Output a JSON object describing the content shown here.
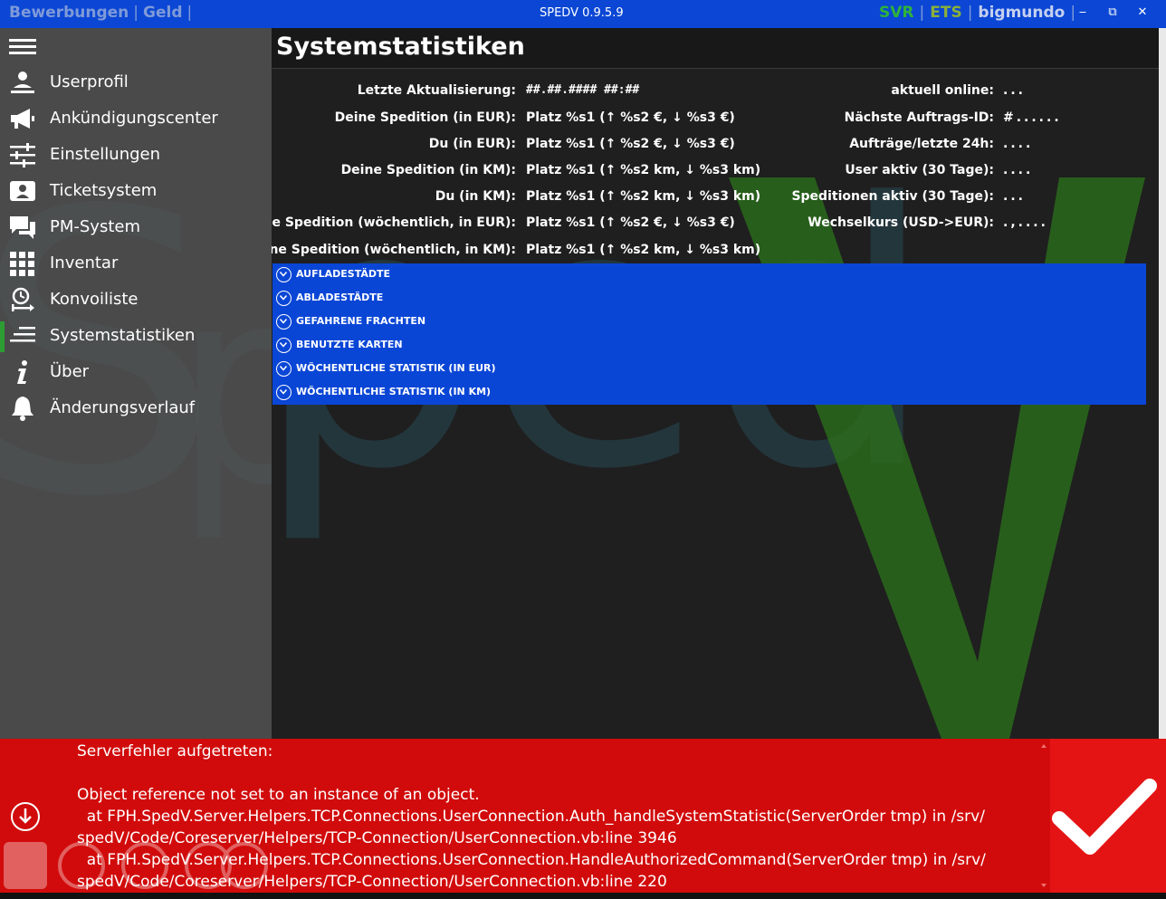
{
  "titlebar": {
    "left_links": [
      "Bewerbungen",
      "Geld"
    ],
    "title": "SPEDV 0.9.5.9",
    "right_links": [
      "SVR",
      "ETS",
      "bigmundo"
    ],
    "minimize_label": "‒",
    "restore_label": "⧉",
    "close_label": "✕"
  },
  "sidebar": {
    "items": [
      {
        "label": "Userprofil",
        "icon": "user-icon"
      },
      {
        "label": "Ankündigungscenter",
        "icon": "megaphone-icon"
      },
      {
        "label": "Einstellungen",
        "icon": "sliders-icon"
      },
      {
        "label": "Ticketsystem",
        "icon": "ticket-icon"
      },
      {
        "label": "PM-System",
        "icon": "chat-icon"
      },
      {
        "label": "Inventar",
        "icon": "grid-icon"
      },
      {
        "label": "Konvoiliste",
        "icon": "convoy-icon"
      },
      {
        "label": "Systemstatistiken",
        "icon": "list-icon",
        "active": true
      },
      {
        "label": "Über",
        "icon": "info-icon"
      },
      {
        "label": "Änderungsverlauf",
        "icon": "bell-icon"
      }
    ]
  },
  "main": {
    "title": "Systemstatistiken",
    "left_stats": [
      {
        "label": "Letzte Aktualisierung:",
        "value": "##.##.#### ##:##"
      },
      {
        "label": "Deine Spedition (in EUR):",
        "value": "Platz %s1 (↑ %s2 €, ↓ %s3 €)"
      },
      {
        "label": "Du (in EUR):",
        "value": "Platz %s1 (↑ %s2 €, ↓ %s3 €)"
      },
      {
        "label": "Deine Spedition (in KM):",
        "value": "Platz %s1 (↑ %s2 km, ↓ %s3 km)"
      },
      {
        "label": "Du (in KM):",
        "value": "Platz %s1 (↑ %s2 km, ↓ %s3 km)"
      },
      {
        "label": "Deine Spedition (wöchentlich, in EUR):",
        "value": "Platz %s1 (↑ %s2 €, ↓ %s3 €)"
      },
      {
        "label": "Deine Spedition (wöchentlich, in KM):",
        "value": "Platz %s1 (↑ %s2 km, ↓ %s3 km)"
      }
    ],
    "right_stats": [
      {
        "label": "aktuell online:",
        "value": "..."
      },
      {
        "label": "Nächste Auftrags-ID:",
        "value": "#......"
      },
      {
        "label": "Aufträge/letzte 24h:",
        "value": "...."
      },
      {
        "label": "User aktiv (30 Tage):",
        "value": "...."
      },
      {
        "label": "Speditionen aktiv (30 Tage):",
        "value": "..."
      },
      {
        "label": "Wechselkurs (USD->EUR):",
        "value": ".,...."
      }
    ],
    "sections": [
      "AUFLADESTÄDTE",
      "ABLADESTÄDTE",
      "GEFAHRENE FRACHTEN",
      "BENUTZTE KARTEN",
      "WÖCHENTLICHE STATISTIK (IN EUR)",
      "WÖCHENTLICHE STATISTIK (IN KM)"
    ]
  },
  "error": {
    "lines": [
      "Serverfehler aufgetreten:",
      "",
      "Object reference not set to an instance of an object.",
      "  at FPH.SpedV.Server.Helpers.TCP.Connections.UserConnection.Auth_handleSystemStatistic(ServerOrder tmp) in /srv/",
      "spedV/Code/Coreserver/Helpers/TCP-Connection/UserConnection.vb:line 3946",
      "  at FPH.SpedV.Server.Helpers.TCP.Connections.UserConnection.HandleAuthorizedCommand(ServerOrder tmp) in /srv/",
      "spedV/Code/Coreserver/Helpers/TCP-Connection/UserConnection.vb:line 220"
    ]
  },
  "colors": {
    "titlebar": "#0b47d4",
    "accordion": "#0a46d6",
    "error": "#d10b0b",
    "active_indicator": "#2d9c32"
  }
}
